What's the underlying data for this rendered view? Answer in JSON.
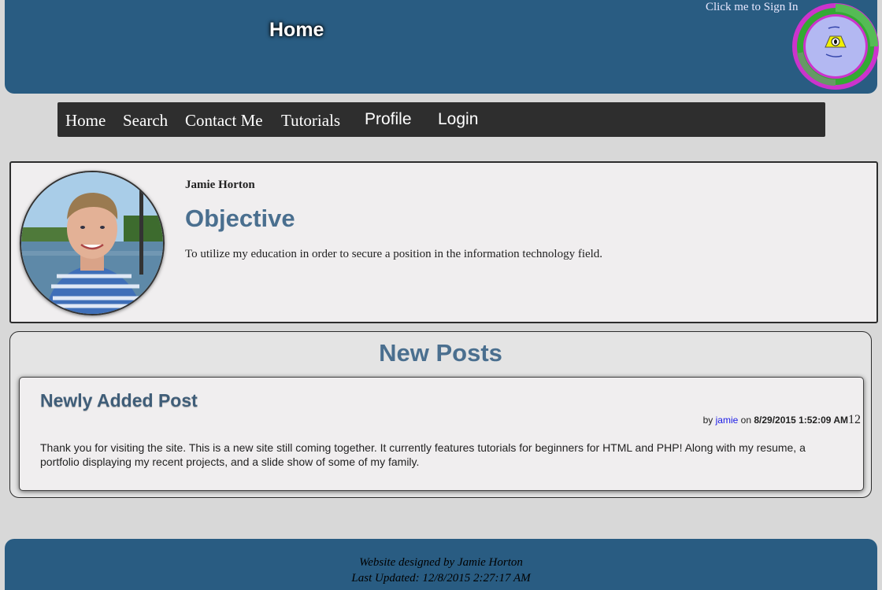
{
  "header": {
    "title": "Home",
    "signin_text": "Click me to Sign In"
  },
  "nav": {
    "items": [
      {
        "label": "Home"
      },
      {
        "label": "Search"
      },
      {
        "label": "Contact Me"
      },
      {
        "label": "Tutorials"
      },
      {
        "label": "Profile"
      },
      {
        "label": "Login"
      }
    ]
  },
  "profile": {
    "name": "Jamie Horton",
    "heading": "Objective",
    "objective": "To utilize my education in order to secure a position in the information technology field."
  },
  "posts": {
    "section_title": "New Posts",
    "items": [
      {
        "title": "Newly Added Post",
        "by_label": "by",
        "author": "jamie",
        "on_label": "on",
        "date": "8/29/2015 1:52:09 AM",
        "count": "12",
        "body": "Thank you for visiting the site. This is a new site still coming together. It currently features tutorials for beginners for HTML and PHP! Along with my resume, a portfolio displaying my recent projects, and a slide show of some of my family."
      }
    ]
  },
  "footer": {
    "designed_by": "Website designed by Jamie Horton",
    "last_updated": "Last Updated: 12/8/2015 2:27:17 AM"
  },
  "colors": {
    "header_bg": "#295c82",
    "navbar_bg": "#2e2e2e",
    "accent_heading": "#4a6f8f",
    "link": "#1a1ae6",
    "page_bg": "#d8d8d8"
  }
}
